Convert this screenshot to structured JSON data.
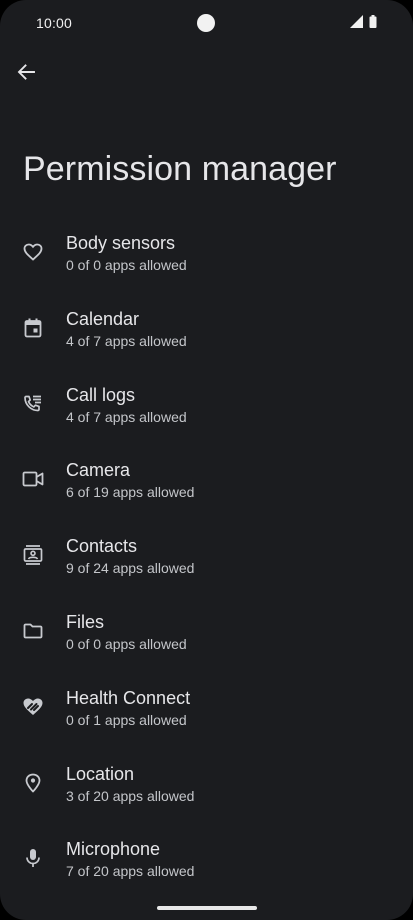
{
  "status_bar": {
    "time": "10:00",
    "icons": [
      "signal-icon",
      "battery-icon"
    ]
  },
  "header": {
    "back_icon": "arrow-back-icon",
    "title": "Permission manager"
  },
  "permissions": [
    {
      "label": "Body sensors",
      "summary": "0 of 0 apps allowed",
      "icon": "heart-icon"
    },
    {
      "label": "Calendar",
      "summary": "4 of 7 apps allowed",
      "icon": "calendar-icon"
    },
    {
      "label": "Call logs",
      "summary": "4 of 7 apps allowed",
      "icon": "call-log-icon"
    },
    {
      "label": "Camera",
      "summary": "6 of 19 apps allowed",
      "icon": "video-camera-icon"
    },
    {
      "label": "Contacts",
      "summary": "9 of 24 apps allowed",
      "icon": "contacts-icon"
    },
    {
      "label": "Files",
      "summary": "0 of 0 apps allowed",
      "icon": "folder-icon"
    },
    {
      "label": "Health Connect",
      "summary": "0 of 1 apps allowed",
      "icon": "health-connect-icon"
    },
    {
      "label": "Location",
      "summary": "3 of 20 apps allowed",
      "icon": "location-pin-icon"
    },
    {
      "label": "Microphone",
      "summary": "7 of 20 apps allowed",
      "icon": "microphone-icon"
    }
  ],
  "colors": {
    "background": "#1b1c1f",
    "text_primary": "#e6e6e9",
    "text_secondary": "#c4c6ca"
  }
}
